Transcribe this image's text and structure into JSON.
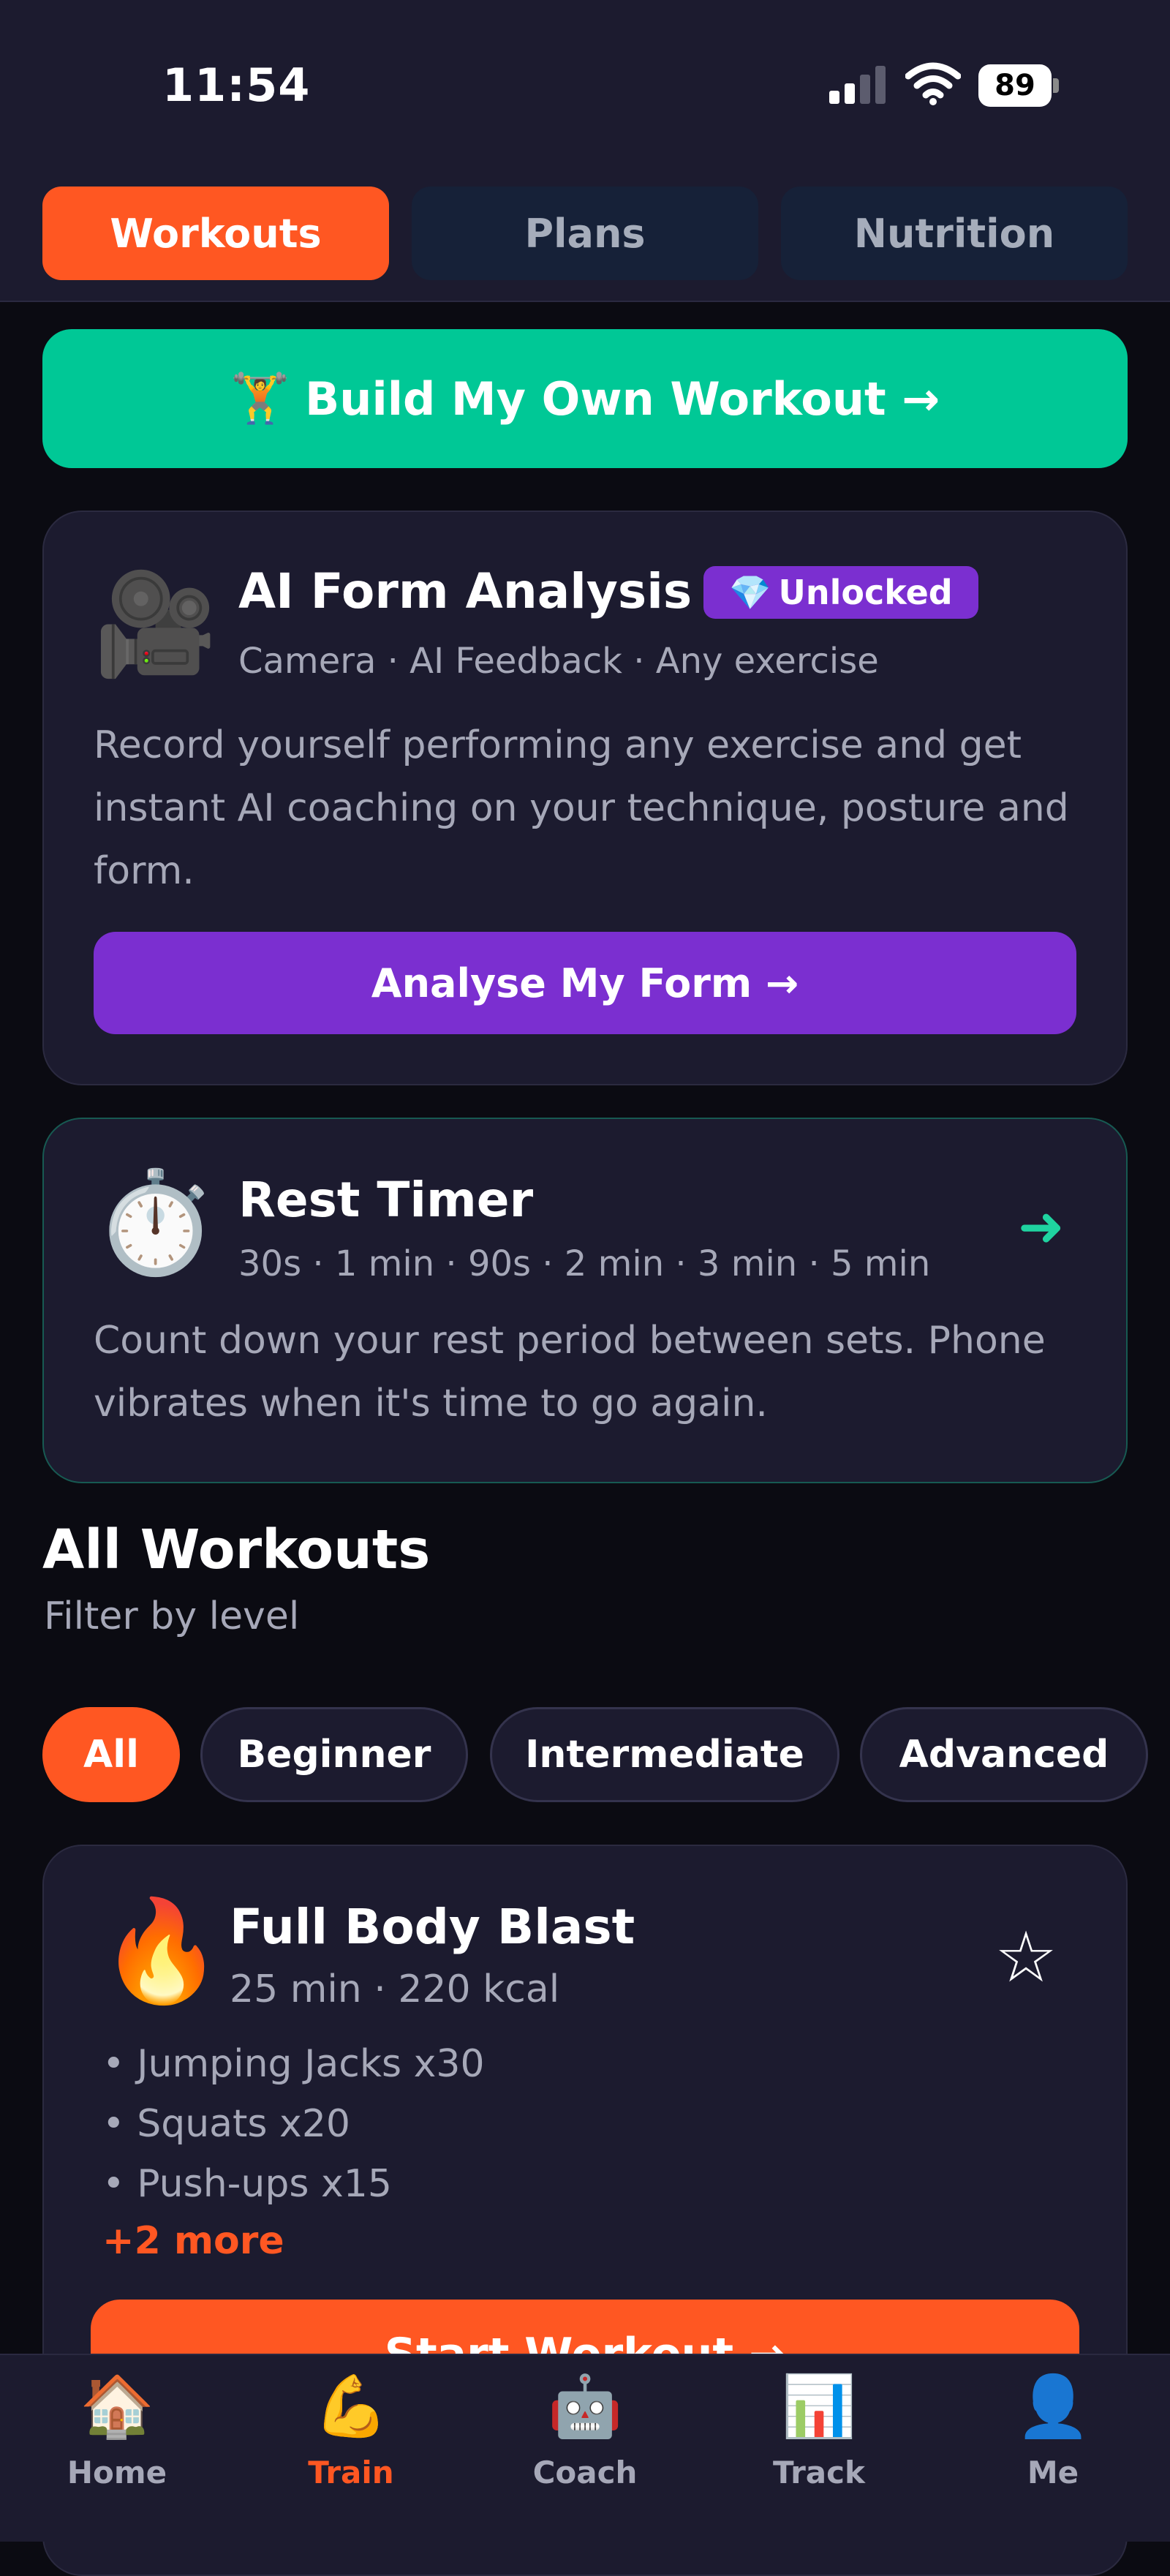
{
  "status_bar": {
    "time": "11:54",
    "battery": "89"
  },
  "top_tabs": [
    {
      "label": "Workouts",
      "active": true
    },
    {
      "label": "Plans",
      "active": false
    },
    {
      "label": "Nutrition",
      "active": false
    }
  ],
  "build_button": {
    "emoji": "🏋️",
    "label": "Build My Own Workout →"
  },
  "form_analysis": {
    "emoji": "🎥",
    "title": "AI Form Analysis",
    "badge_emoji": "💎",
    "badge_label": "Unlocked",
    "subtitle": "Camera · AI Feedback · Any exercise",
    "description_line1": "Record yourself performing any exercise and get",
    "description_line2": "instant AI coaching on your technique, posture and",
    "description_line3": "form.",
    "button_label": "Analyse My Form →"
  },
  "rest_timer": {
    "emoji": "⏱️",
    "title": "Rest Timer",
    "subtitle": "30s · 1 min · 90s · 2 min · 3 min · 5 min",
    "description_line1": "Count down your rest period between sets. Phone",
    "description_line2": "vibrates when it's time to go again.",
    "arrow": "➜"
  },
  "all_workouts": {
    "title": "All Workouts",
    "subtitle": "Filter by level",
    "filters": [
      {
        "label": "All",
        "active": true
      },
      {
        "label": "Beginner",
        "active": false
      },
      {
        "label": "Intermediate",
        "active": false
      },
      {
        "label": "Advanced",
        "active": false
      }
    ]
  },
  "workout_card": {
    "emoji": "🔥",
    "title": "Full Body Blast",
    "meta": "25 min · 220 kcal",
    "star": "☆",
    "exercises": [
      "• Jumping Jacks x30",
      "• Squats x20",
      "• Push-ups x15"
    ],
    "more": "+2 more",
    "button_label": "Start Workout →"
  },
  "bottom_nav": [
    {
      "icon": "🏠",
      "label": "Home",
      "active": false
    },
    {
      "icon": "💪",
      "label": "Train",
      "active": true
    },
    {
      "icon": "🤖",
      "label": "Coach",
      "active": false
    },
    {
      "icon": "📊",
      "label": "Track",
      "active": false
    },
    {
      "icon": "👤",
      "label": "Me",
      "active": false
    }
  ],
  "colors": {
    "accent_orange": "#ff5722",
    "accent_green": "#00c896",
    "accent_purple": "#7b2fd0",
    "card_bg": "#1c1b2f",
    "page_bg": "#0b0b12"
  }
}
